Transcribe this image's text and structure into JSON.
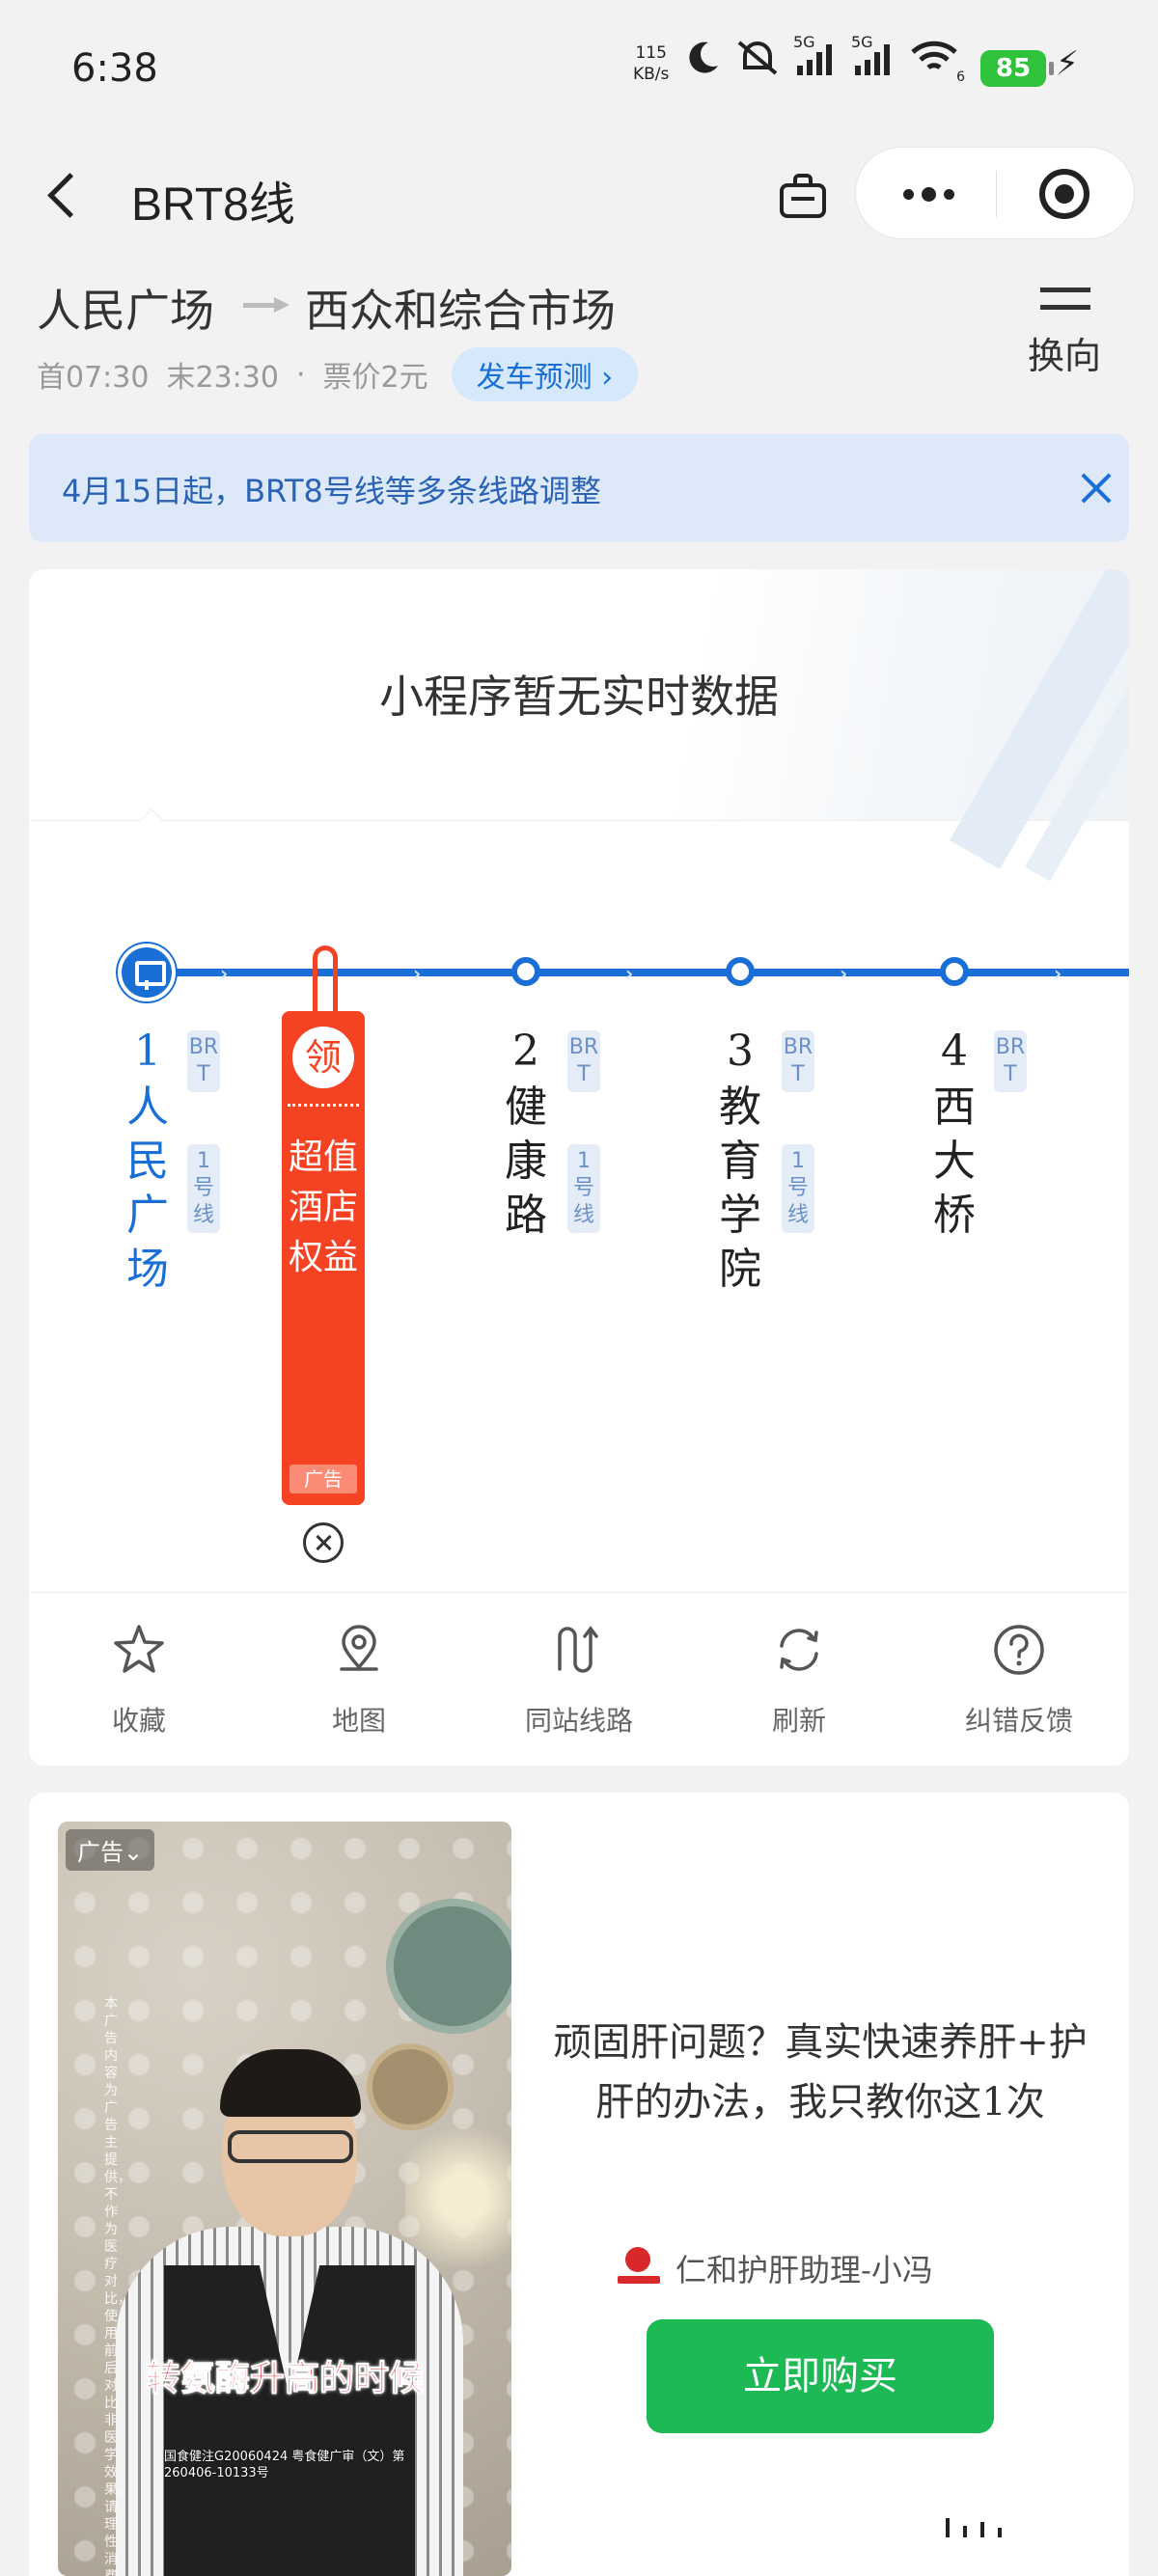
{
  "status_bar": {
    "time": "6:38",
    "net_speed": "115",
    "net_unit": "KB/s",
    "signal_1": "5G",
    "signal_2": "5G",
    "wifi_num": "6",
    "battery": "85"
  },
  "nav": {
    "title": "BRT8线"
  },
  "route": {
    "from": "人民广场",
    "to": "西众和综合市场",
    "first_bus": "首07:30",
    "last_bus": "末23:30",
    "dot": "·",
    "fare": "票价2元",
    "predict_label": "发车预测 ›",
    "swap_label": "换向"
  },
  "notice": {
    "text": "4月15日起，BRT8号线等多条线路调整"
  },
  "realtime": {
    "message": "小程序暂无实时数据"
  },
  "stops": [
    {
      "num": "1",
      "name": "人民广场",
      "tag1": "BRT",
      "tag2": "1号线"
    },
    {
      "num": "2",
      "name": "健康路",
      "tag1": "BRT",
      "tag2": "1号线"
    },
    {
      "num": "3",
      "name": "教育学院",
      "tag1": "BRT",
      "tag2": "1号线"
    },
    {
      "num": "4",
      "name": "西大桥",
      "tag1": "BRT",
      "tag2": ""
    }
  ],
  "coupon": {
    "badge": "领",
    "text": "超值酒店权益",
    "ad_label": "广告"
  },
  "actions": [
    {
      "label": "收藏",
      "icon": "star-icon"
    },
    {
      "label": "地图",
      "icon": "map-pin-icon"
    },
    {
      "label": "同站线路",
      "icon": "route-icon"
    },
    {
      "label": "刷新",
      "icon": "refresh-icon"
    },
    {
      "label": "纠错反馈",
      "icon": "help-icon"
    }
  ],
  "ad": {
    "badge": "广告⌄",
    "side_text": "本广告内容为广告主提供，不作为医疗对比，使用前后对比非医学效果，请理性消费",
    "caption": "转氨酶升高的时候",
    "fine_print": "国食健注G20060424 粤食健广审（文）第260406-10133号",
    "headline": "顽固肝问题？真实快速养肝+护肝的办法，我只教你这1次",
    "brand_name": "仁和护肝助理-小冯",
    "buy_label": "立即购买"
  },
  "colors": {
    "accent_blue": "#1a6fd6",
    "coupon_red": "#f44223",
    "buy_green": "#1db954",
    "battery_green": "#2fc23a"
  }
}
